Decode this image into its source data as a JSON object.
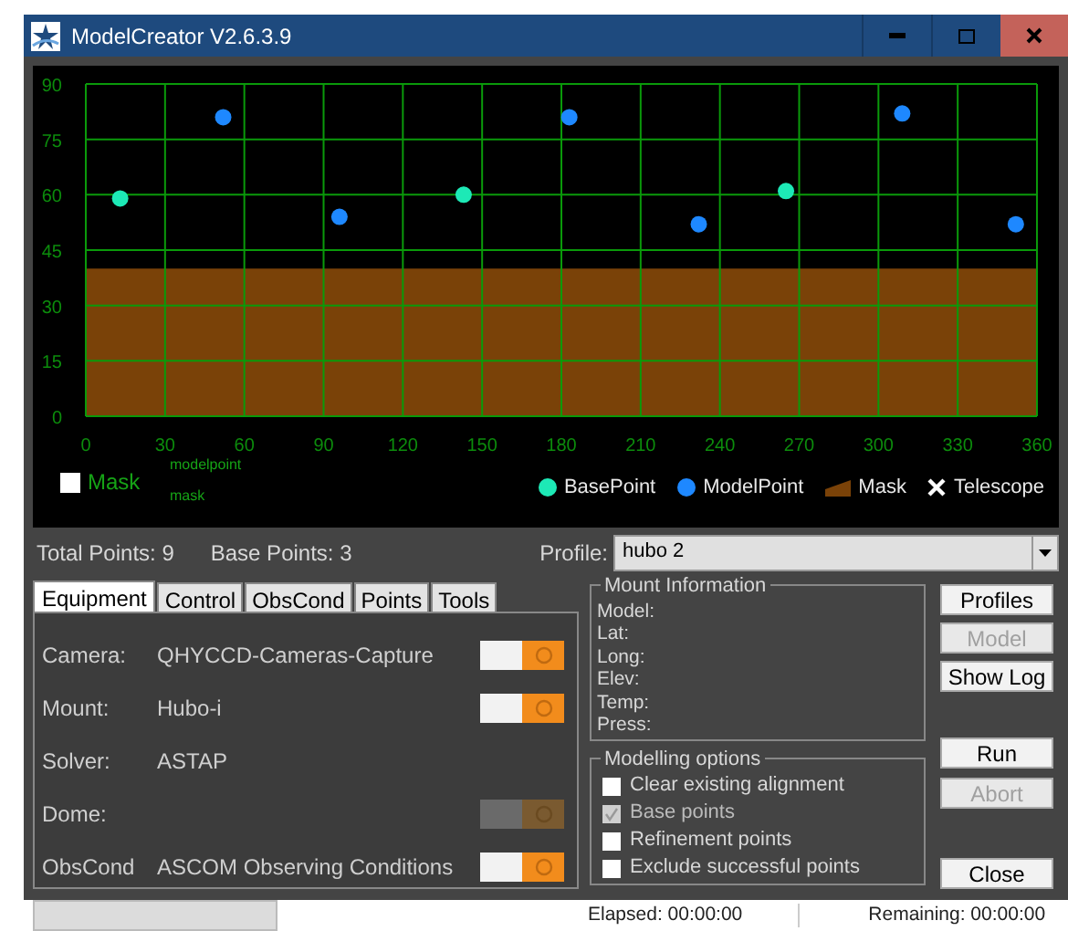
{
  "window": {
    "title": "ModelCreator V2.6.3.9"
  },
  "chart": {
    "chart_data": {
      "type": "scatter",
      "grid": true,
      "xlim": [
        0,
        360
      ],
      "ylim": [
        0,
        90
      ],
      "xticks": [
        0,
        30,
        60,
        90,
        120,
        150,
        180,
        210,
        240,
        270,
        300,
        330,
        360
      ],
      "yticks": [
        0,
        15,
        30,
        45,
        60,
        75,
        90
      ],
      "series": [
        {
          "name": "BasePoint",
          "type": "scatter",
          "color": "#1de9b6",
          "x": [
            13,
            143,
            265
          ],
          "values": [
            59,
            60,
            61
          ]
        },
        {
          "name": "ModelPoint",
          "type": "scatter",
          "color": "#1e88ff",
          "x": [
            52,
            96,
            183,
            232,
            309,
            352
          ],
          "values": [
            81,
            54,
            81,
            52,
            82,
            52
          ]
        },
        {
          "name": "Mask",
          "type": "area",
          "color": "#7a4208",
          "x": [
            0,
            360
          ],
          "values": [
            40,
            40
          ]
        }
      ]
    },
    "mask_checkbox": {
      "label": "Mask",
      "checked": false
    },
    "small_labels": [
      "modelpoint",
      "mask"
    ],
    "telescope_legend": {
      "label": "Telescope"
    }
  },
  "summary": {
    "total": "Total Points: 9",
    "base": "Base Points: 3"
  },
  "profile": {
    "label": "Profile:",
    "value": "hubo 2"
  },
  "tabs": [
    {
      "label": "Equipment",
      "selected": true
    },
    {
      "label": "Control",
      "selected": false
    },
    {
      "label": "ObsCond",
      "selected": false
    },
    {
      "label": "Points",
      "selected": false
    },
    {
      "label": "Tools",
      "selected": false
    }
  ],
  "equipment": [
    {
      "label": "Camera:",
      "value": "QHYCCD-Cameras-Capture",
      "on": true,
      "disabled": false
    },
    {
      "label": "Mount:",
      "value": "Hubo-i",
      "on": true,
      "disabled": false
    },
    {
      "label": "Solver:",
      "value": "ASTAP",
      "kind": "plain"
    },
    {
      "label": "Dome:",
      "on": true,
      "disabled": true
    },
    {
      "label": "ObsCond",
      "value": "ASCOM Observing Conditions",
      "on": true,
      "disabled": false
    }
  ],
  "mount_information": {
    "title": "Mount Information",
    "fields": [
      "Model:",
      "Lat:",
      "Long:",
      "Elev:",
      "Temp:",
      "Press:"
    ]
  },
  "modelling_options": {
    "title": "Modelling options",
    "options": [
      {
        "label": "Clear existing alignment",
        "checked": false,
        "disabled": false
      },
      {
        "label": "Base points",
        "checked": true,
        "disabled": true
      },
      {
        "label": "Refinement points",
        "checked": false,
        "disabled": false
      },
      {
        "label": "Exclude successful points",
        "checked": false,
        "disabled": false
      }
    ]
  },
  "buttons": [
    {
      "label": "Profiles",
      "disabled": false
    },
    {
      "label": "Model",
      "disabled": true
    },
    {
      "label": "Show Log",
      "disabled": false
    },
    {
      "label": "Run",
      "disabled": false
    },
    {
      "label": "Abort",
      "disabled": true
    },
    {
      "label": "Close",
      "disabled": false
    }
  ],
  "status_bar": {
    "progress": {
      "level": 0
    },
    "elapsed": "Elapsed: 00:00:00",
    "remaining": "Remaining: 00:00:00"
  }
}
